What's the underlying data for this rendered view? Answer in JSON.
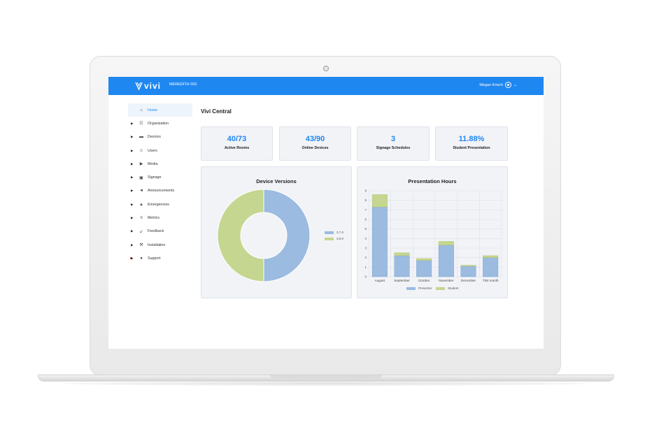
{
  "header": {
    "logo_text": "vivi",
    "district": "MEREDITH ISD",
    "user_name": "Megan Kirsch",
    "primary_color": "#1f87f0"
  },
  "sidebar": {
    "items": [
      {
        "label": "Home",
        "icon": "home-icon",
        "active": true,
        "expandable": false
      },
      {
        "label": "Organization",
        "icon": "organization-icon",
        "expandable": true
      },
      {
        "label": "Devices",
        "icon": "devices-icon",
        "expandable": true
      },
      {
        "label": "Users",
        "icon": "users-icon",
        "expandable": true
      },
      {
        "label": "Media",
        "icon": "media-icon",
        "expandable": true
      },
      {
        "label": "Signage",
        "icon": "signage-icon",
        "expandable": true
      },
      {
        "label": "Announcements",
        "icon": "megaphone-icon",
        "expandable": true
      },
      {
        "label": "Emergencies",
        "icon": "warning-icon",
        "expandable": true
      },
      {
        "label": "Metrics",
        "icon": "metrics-icon",
        "expandable": true
      },
      {
        "label": "Feedback",
        "icon": "feedback-icon",
        "expandable": true
      },
      {
        "label": "Installation",
        "icon": "installation-icon",
        "expandable": true
      },
      {
        "label": "Support",
        "icon": "help-icon",
        "expandable": true,
        "alert_dot": true
      }
    ]
  },
  "main": {
    "title": "Vivi Central",
    "stats": [
      {
        "value": "40/73",
        "label": "Active Rooms"
      },
      {
        "value": "43/90",
        "label": "Online Devices"
      },
      {
        "value": "3",
        "label": "Signage Schedules"
      },
      {
        "value": "11.88%",
        "label": "Student Presentation"
      }
    ],
    "device_versions": {
      "title": "Device Versions",
      "legend": [
        {
          "label": "3.7.0",
          "color": "#9bbbe0"
        },
        {
          "label": "3.5.0",
          "color": "#c4d68f"
        }
      ]
    },
    "presentation_hours": {
      "title": "Presentation Hours",
      "legend": [
        {
          "label": "Presenter",
          "color": "#9bbbe0"
        },
        {
          "label": "Student",
          "color": "#c4d68f"
        }
      ]
    }
  },
  "chart_data": [
    {
      "type": "pie",
      "title": "Device Versions",
      "donut": true,
      "labels": [
        "3.7.0",
        "3.5.0"
      ],
      "values": [
        50,
        50
      ],
      "colors": [
        "#9bbbe0",
        "#c4d68f"
      ],
      "legend": "right"
    },
    {
      "type": "bar",
      "stacked": true,
      "title": "Presentation Hours",
      "categories": [
        "August",
        "September",
        "October",
        "November",
        "December",
        "This month"
      ],
      "series": [
        {
          "name": "Presenter",
          "values": [
            7.3,
            2.2,
            1.7,
            3.3,
            1.1,
            2.0
          ],
          "color": "#9bbbe0"
        },
        {
          "name": "Student",
          "values": [
            1.3,
            0.3,
            0.2,
            0.4,
            0.1,
            0.2
          ],
          "color": "#c4d68f"
        }
      ],
      "ylim": [
        0,
        9
      ],
      "yticks": [
        0,
        1,
        2,
        3,
        4,
        5,
        6,
        7,
        8,
        9
      ],
      "grid": true,
      "legend": "bottom"
    }
  ]
}
